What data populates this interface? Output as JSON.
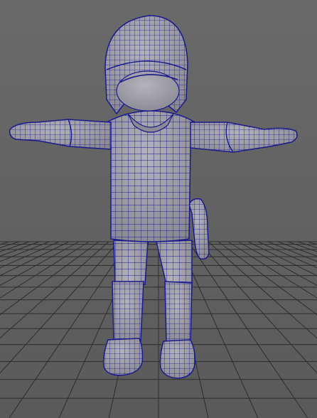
{
  "viewport": {
    "background_color": "#686868",
    "grid_color": "#2b2b2b",
    "model_fill": "#9b9aa3",
    "model_shadow": "#6f6f78",
    "wire_color": "#1a1a8c"
  },
  "scene": {
    "object_type": "polygon-mesh-character",
    "display_mode": "wireframe-on-shaded",
    "pose": "t-pose"
  }
}
